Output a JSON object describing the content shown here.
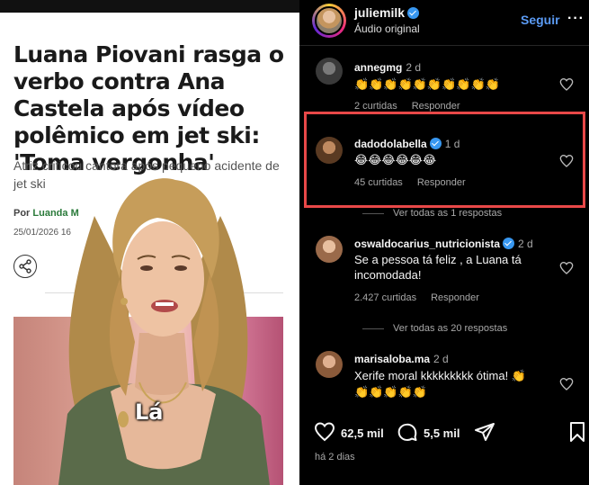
{
  "article": {
    "headline": "Luana Piovani rasga o verbo contra Ana Castela após vídeo polêmico em jet ski: 'Toma vergonha'",
    "subtitle": "Atriz criticou cantora após pequeno acidente de jet ski",
    "byline_prefix": "Por",
    "author": "Luanda M",
    "date": "25/01/2026 16",
    "share_icon": "share-icon"
  },
  "video": {
    "caption": "Lá"
  },
  "instagram": {
    "header": {
      "username": "juliemilk",
      "audio": "Áudio original",
      "follow_label": "Seguir",
      "more_label": "···"
    },
    "comments": [
      {
        "username": "annegmg",
        "time": "2 d",
        "text": "👏👏👏👏👏👏👏👏👏👏",
        "likes": "2 curtidas",
        "reply_label": "Responder",
        "avatar_color": "#3a3a3a"
      },
      {
        "username": "dadodolabella",
        "verified": true,
        "time": "1 d",
        "text": "😂😂😂😂😂😂",
        "likes": "45 curtidas",
        "reply_label": "Responder",
        "replies": "Ver todas as 1 respostas",
        "avatar_color": "#8a5a3a"
      },
      {
        "username": "oswaldocarius_nutricionista",
        "verified": true,
        "time": "2 d",
        "text": "Se a pessoa tá feliz , a Luana tá incomodada!",
        "likes": "2.427 curtidas",
        "reply_label": "Responder",
        "replies": "Ver todas as 20 respostas",
        "avatar_color": "#c89a7a"
      },
      {
        "username": "marisaloba.ma",
        "time": "2 d",
        "text": "Xerife moral kkkkkkkkk ótima! 👏",
        "text2": "👏👏👏👏👏",
        "avatar_color": "#b07a55"
      }
    ],
    "actions": {
      "likes": "62,5 mil",
      "comments": "5,5 mil"
    },
    "post_time": "há 2 dias"
  },
  "colors": {
    "accent_follow": "#5b9bf5",
    "verified": "#3897f0",
    "highlight": "#e84848"
  }
}
